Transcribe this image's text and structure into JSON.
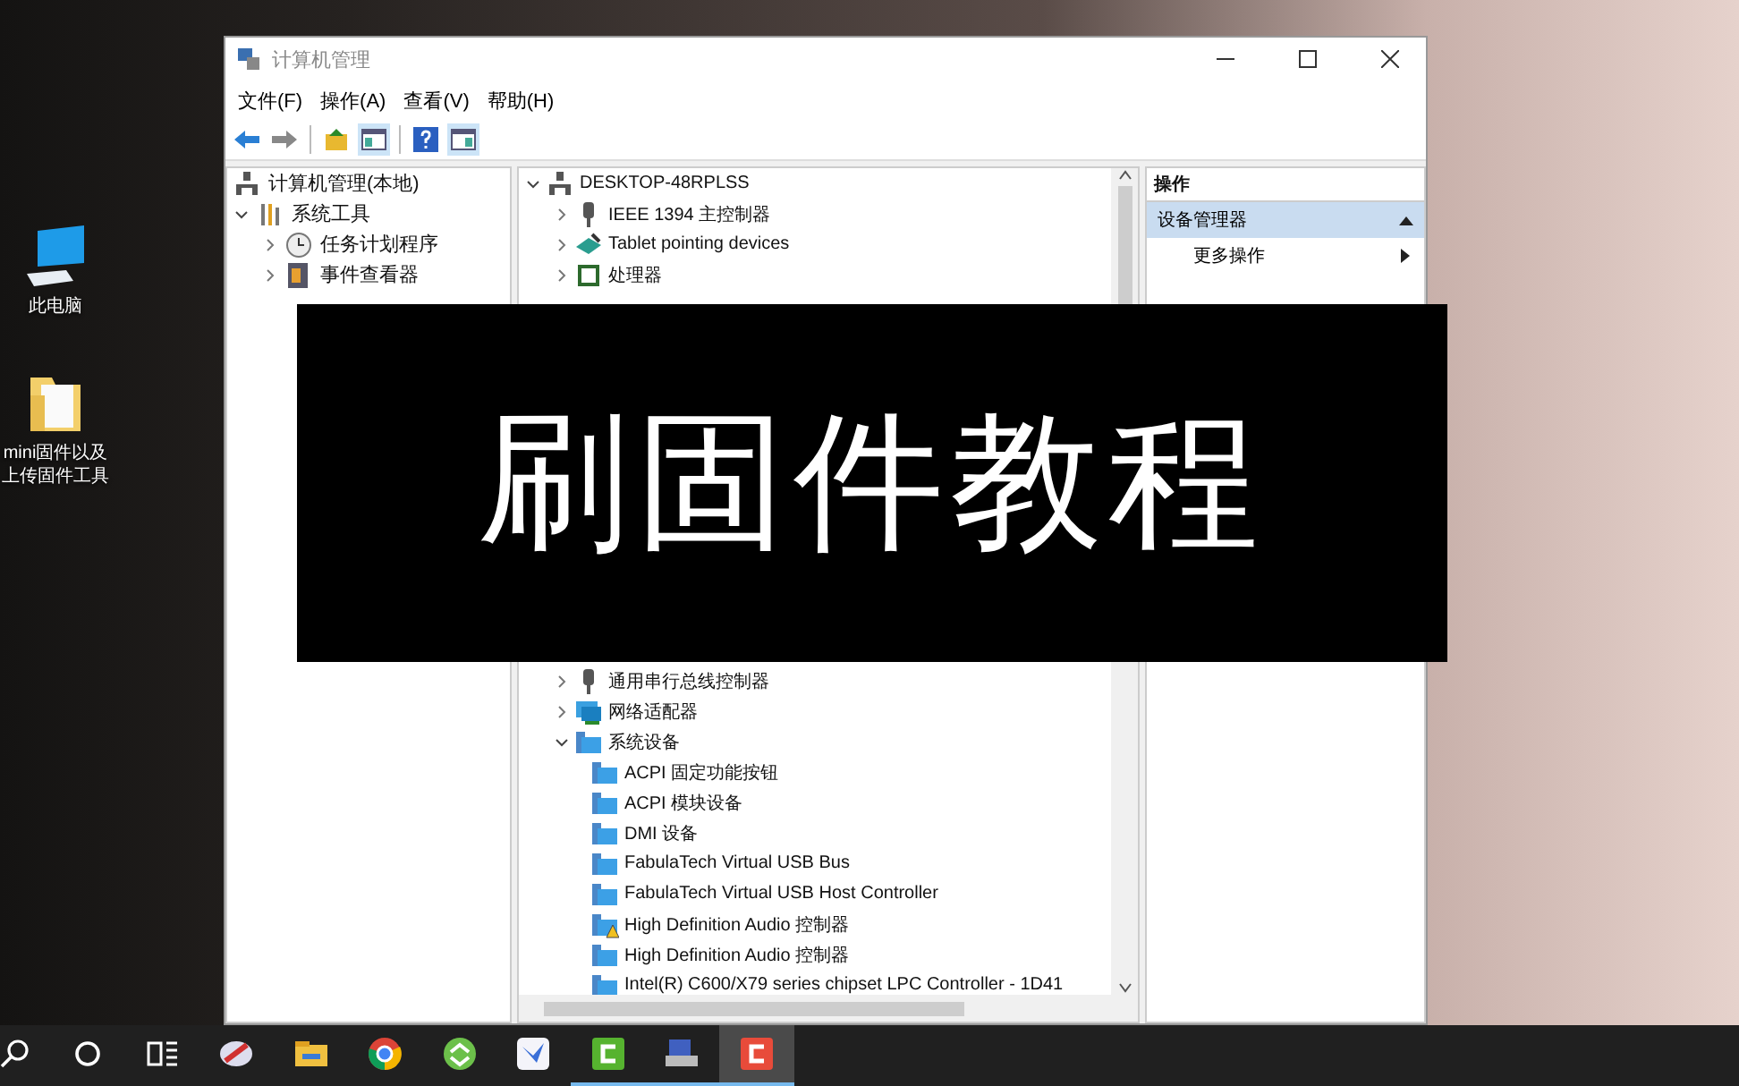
{
  "desktop_icons": [
    {
      "kind": "computer",
      "lines": [
        "此电脑"
      ]
    },
    {
      "kind": "folder",
      "lines": [
        "mini固件以及",
        "上传固件工具"
      ]
    }
  ],
  "window": {
    "title": "计算机管理",
    "menu": [
      "文件(F)",
      "操作(A)",
      "查看(V)",
      "帮助(H)"
    ]
  },
  "tree": {
    "label": "计算机管理(本地)",
    "children": [
      {
        "label": "系统工具",
        "expanded": true,
        "children": [
          {
            "label": "任务计划程序",
            "kind": "clock",
            "expanded": false
          },
          {
            "label": "事件查看器",
            "kind": "log",
            "expanded": false
          }
        ]
      }
    ]
  },
  "devices": {
    "computer": "DESKTOP-48RPLSS",
    "upper": [
      {
        "label": "IEEE 1394 主控制器",
        "kind": "usb",
        "expanded": false
      },
      {
        "label": "Tablet pointing devices",
        "kind": "tablet",
        "expanded": false
      },
      {
        "label": "处理器",
        "kind": "cpu",
        "expanded": false
      }
    ],
    "lower": [
      {
        "label": "通用串行总线控制器",
        "kind": "usb",
        "expanded": false
      },
      {
        "label": "网络适配器",
        "kind": "network",
        "expanded": false
      },
      {
        "label": "系统设备",
        "kind": "system",
        "expanded": true,
        "children": [
          {
            "label": "ACPI 固定功能按钮",
            "warning": false
          },
          {
            "label": "ACPI 模块设备",
            "warning": false
          },
          {
            "label": "DMI 设备",
            "warning": false
          },
          {
            "label": "FabulaTech Virtual USB Bus",
            "warning": false
          },
          {
            "label": "FabulaTech Virtual USB Host Controller",
            "warning": false
          },
          {
            "label": "High Definition Audio 控制器",
            "warning": true
          },
          {
            "label": "High Definition Audio 控制器",
            "warning": false
          },
          {
            "label": "Intel(R) C600/X79 series chipset LPC Controller - 1D41",
            "warning": false
          }
        ]
      }
    ]
  },
  "actions": {
    "title": "操作",
    "section": "设备管理器",
    "items": [
      "更多操作"
    ]
  },
  "overlay": {
    "text": "刷固件教程"
  },
  "taskbar": [
    {
      "kind": "search",
      "running": false,
      "selected": false
    },
    {
      "kind": "cortana",
      "running": false,
      "selected": false
    },
    {
      "kind": "taskview",
      "running": false,
      "selected": false
    },
    {
      "kind": "paint",
      "running": false,
      "selected": false
    },
    {
      "kind": "explorer",
      "running": false,
      "selected": false
    },
    {
      "kind": "chrome",
      "running": false,
      "selected": false
    },
    {
      "kind": "green-circle",
      "running": false,
      "selected": false
    },
    {
      "kind": "bird",
      "running": false,
      "selected": false
    },
    {
      "kind": "camtasia-green",
      "running": true,
      "selected": false
    },
    {
      "kind": "network",
      "running": true,
      "selected": false
    },
    {
      "kind": "camtasia-red",
      "running": true,
      "selected": true
    }
  ]
}
